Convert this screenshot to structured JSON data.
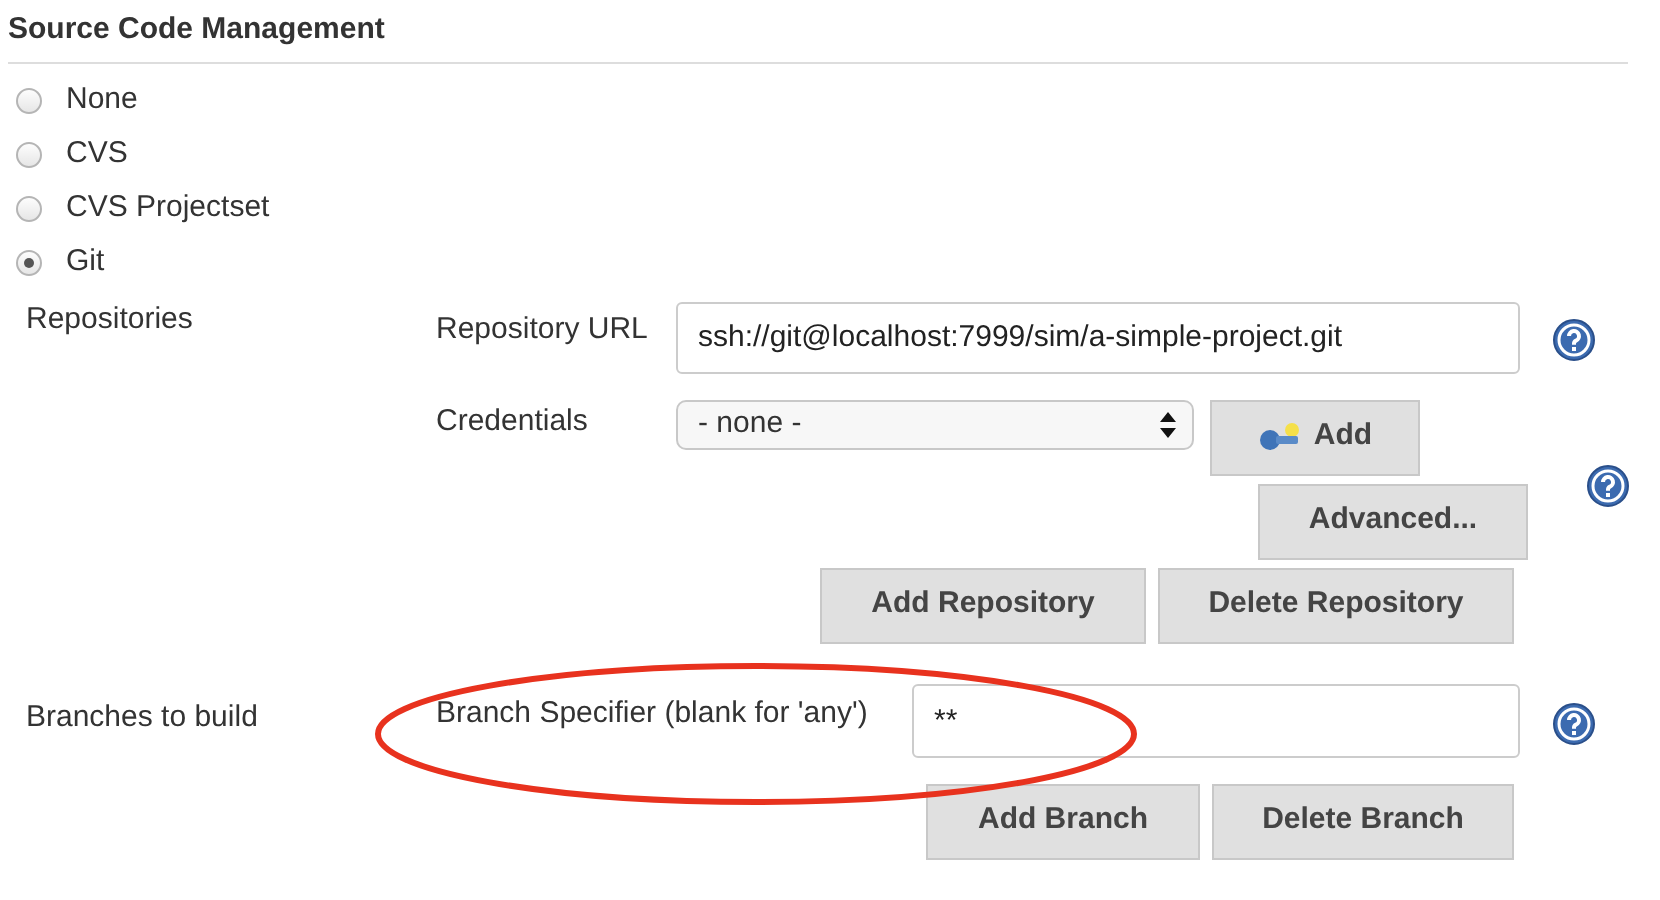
{
  "section": {
    "title": "Source Code Management"
  },
  "scm_options": [
    {
      "label": "None",
      "selected": false
    },
    {
      "label": "CVS",
      "selected": false
    },
    {
      "label": "CVS Projectset",
      "selected": false
    },
    {
      "label": "Git",
      "selected": true
    }
  ],
  "repositories": {
    "label": "Repositories",
    "url_label": "Repository URL",
    "url_value": "ssh://git@localhost:7999/sim/a-simple-project.git",
    "credentials_label": "Credentials",
    "credentials_value": "- none -",
    "add_button": "Add",
    "advanced_button": "Advanced...",
    "add_repository_button": "Add Repository",
    "delete_repository_button": "Delete Repository"
  },
  "branches": {
    "label": "Branches to build",
    "specifier_label": "Branch Specifier (blank for 'any')",
    "specifier_value": "**",
    "add_branch_button": "Add Branch",
    "delete_branch_button": "Delete Branch"
  },
  "highlight": {
    "color": "#e8321e"
  }
}
